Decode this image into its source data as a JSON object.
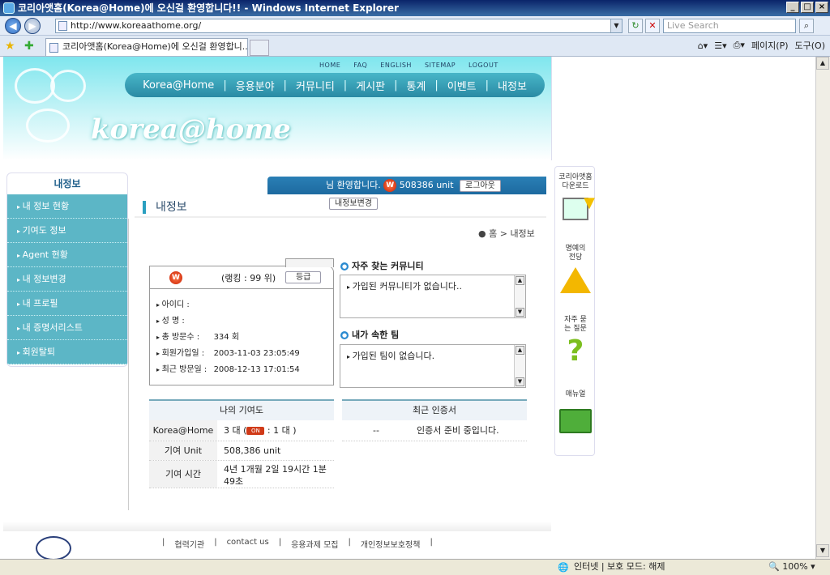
{
  "window": {
    "title": "코리아앳홈(Korea@Home)에 오신걸 환영합니다!! - Windows Internet Explorer"
  },
  "address": {
    "url": "http://www.koreaathome.org/",
    "search_placeholder": "Live Search"
  },
  "tab": {
    "title": "코리아앳홈(Korea@Home)에 오신걸 환영합니..."
  },
  "commandbar": {
    "page": "페이지(P)",
    "tools": "도구(O)"
  },
  "site": {
    "logo_text": "korea@home",
    "top_links": [
      "HOME",
      "FAQ",
      "ENGLISH",
      "SITEMAP",
      "LOGOUT"
    ],
    "gnb": [
      "Korea@Home",
      "응용분야",
      "커뮤니티",
      "게시판",
      "통계",
      "이벤트",
      "내정보"
    ]
  },
  "left": {
    "title": "내정보",
    "items": [
      "내 정보 현황",
      "기여도 정보",
      "Agent 현황",
      "내 정보변경",
      "내 프로필",
      "내 증명서리스트",
      "회원탈퇴"
    ]
  },
  "welcome": {
    "text": "님 환영합니다.",
    "units": "508386 unit",
    "logout": "로그아웃",
    "edit": "내정보변경",
    "coin": "W"
  },
  "page": {
    "title": "내정보",
    "breadcrumb": "홈 > 내정보"
  },
  "profile": {
    "ranking": "(랭킹 : 99 위)",
    "grade_button": "등급",
    "fields": [
      {
        "label": "아이디 :",
        "value": ""
      },
      {
        "label": "성    명 :",
        "value": ""
      },
      {
        "label": "총 방문수 :",
        "value": "334 회"
      },
      {
        "label": "회원가입일 :",
        "value": "2003-11-03 23:05:49"
      },
      {
        "label": "최근 방문일 :",
        "value": "2008-12-13 17:01:54"
      }
    ]
  },
  "community": {
    "title": "자주 찾는 커뮤니티",
    "empty": "가입된 커뮤니티가 없습니다.."
  },
  "team": {
    "title": "내가 속한 팀",
    "empty": "가입된 팀이 없습니다."
  },
  "contribution": {
    "title": "나의 기여도",
    "rows": [
      {
        "label": "Korea@Home",
        "value_pre": "3 대    (",
        "badge": "ON",
        "value_post": ": 1 대 )"
      },
      {
        "label": "기여 Unit",
        "value": "508,386 unit"
      },
      {
        "label": "기여 시간",
        "value": "4년 1개월 2일 19시간 1분 49초"
      }
    ]
  },
  "certificates": {
    "title": "최근 인증서",
    "col1": "--",
    "col2": "인증서 준비 중입니다."
  },
  "rightcol": {
    "items": [
      "코리아앳홈 다운로드",
      "명예의 전당",
      "자주 묻는 질문",
      "매뉴얼"
    ]
  },
  "footer": {
    "links": [
      "|",
      "협력기관",
      "|",
      "contact us",
      "|",
      "응용과제 모집",
      "|",
      "개인정보보호정책",
      "|"
    ]
  },
  "status": {
    "zone": "인터넷 | 보호 모드: 해제",
    "zoom": "100%"
  }
}
